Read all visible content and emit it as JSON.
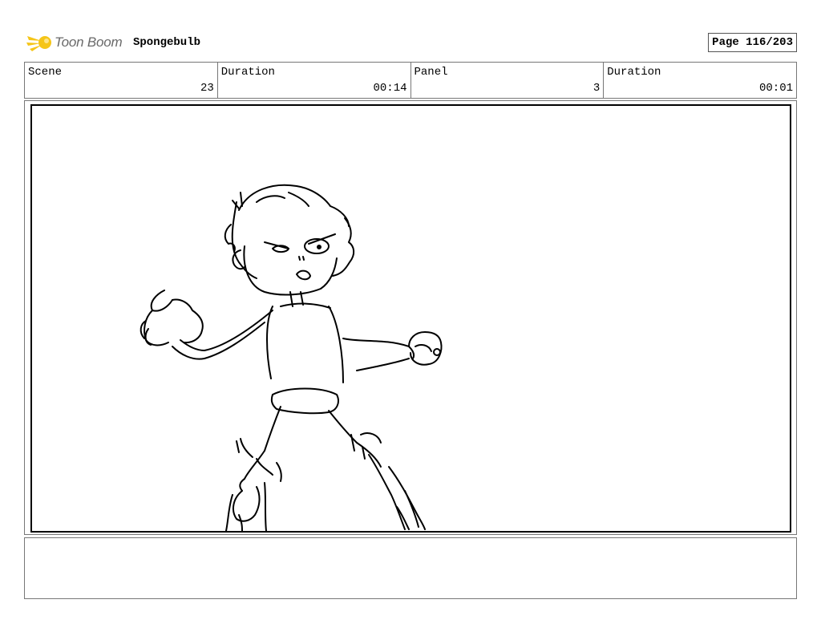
{
  "header": {
    "logo_text": "Toon Boom",
    "project_title": "Spongebulb",
    "page_label": "Page 116/203"
  },
  "info": {
    "scene_label": "Scene",
    "scene_value": "23",
    "scene_duration_label": "Duration",
    "scene_duration_value": "00:14",
    "panel_label": "Panel",
    "panel_value": "3",
    "panel_duration_label": "Duration",
    "panel_duration_value": "00:01"
  },
  "notes": {
    "text": ""
  },
  "colors": {
    "logo_yellow": "#f5c518",
    "logo_text": "#6a6a6a",
    "border": "#777777"
  }
}
